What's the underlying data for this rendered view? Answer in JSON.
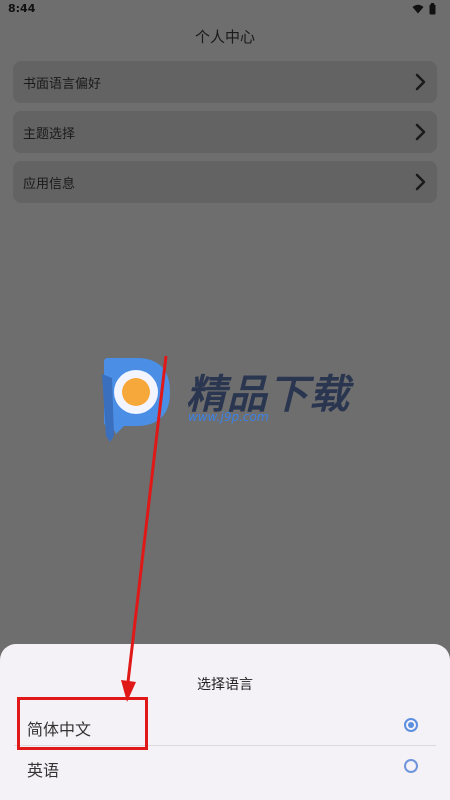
{
  "status_bar": {
    "time": "8:44",
    "wifi_icon": "wifi-icon",
    "battery_icon": "battery-icon"
  },
  "header": {
    "title": "个人中心"
  },
  "menu": {
    "items": [
      {
        "label": "书面语言偏好",
        "icon": "chevron-right-icon"
      },
      {
        "label": "主题选择",
        "icon": "chevron-right-icon"
      },
      {
        "label": "应用信息",
        "icon": "chevron-right-icon"
      }
    ]
  },
  "watermark": {
    "text": "精品下载",
    "url": "www.j9p.com"
  },
  "language_sheet": {
    "title": "选择语言",
    "options": [
      {
        "label": "简体中文",
        "selected": true
      },
      {
        "label": "英语",
        "selected": false
      }
    ]
  },
  "colors": {
    "overlay": "#6e6e6e",
    "sheet_background": "#f4f1f7",
    "radio_accent": "#5b8fe0",
    "annotation_red": "#e01818"
  }
}
